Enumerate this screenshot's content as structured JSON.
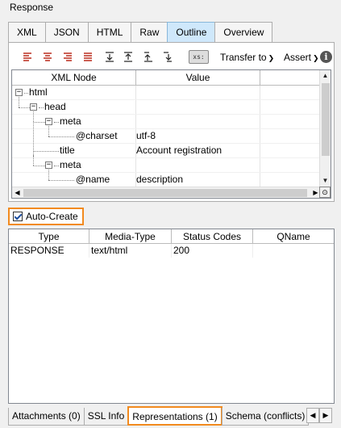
{
  "panel": {
    "title": "Response"
  },
  "format_tabs": [
    {
      "label": "XML"
    },
    {
      "label": "JSON"
    },
    {
      "label": "HTML"
    },
    {
      "label": "Raw"
    },
    {
      "label": "Outline",
      "active": true
    },
    {
      "label": "Overview"
    }
  ],
  "toolbar": {
    "icons": [
      "align-left-icon",
      "align-center-icon",
      "align-right-icon",
      "align-justify-icon",
      "collapse-all-icon",
      "expand-all-icon",
      "move-up-icon",
      "move-down-icon"
    ],
    "xs_label": "xs:",
    "transfer_label": "Transfer to",
    "assert_label": "Assert",
    "info_glyph": "i"
  },
  "outline_table": {
    "columns": [
      "XML Node",
      "Value"
    ],
    "rows": [
      {
        "node": "html",
        "value": ""
      },
      {
        "node": "head",
        "value": ""
      },
      {
        "node": "meta",
        "value": ""
      },
      {
        "node": "@charset",
        "value": "utf-8"
      },
      {
        "node": "title",
        "value": "Account registration"
      },
      {
        "node": "meta",
        "value": ""
      },
      {
        "node": "@name",
        "value": "description"
      }
    ]
  },
  "auto_create": {
    "label": "Auto-Create",
    "checked": true
  },
  "representations_table": {
    "columns": [
      "Type",
      "Media-Type",
      "Status Codes",
      "QName"
    ],
    "rows": [
      {
        "type": "RESPONSE",
        "media_type": "text/html",
        "status_codes": "200",
        "qname": ""
      }
    ]
  },
  "bottom_tabs": [
    {
      "label": "Attachments (0)"
    },
    {
      "label": "SSL Info"
    },
    {
      "label": "Representations (1)",
      "active": true
    },
    {
      "label": "Schema (conflicts)"
    }
  ],
  "colors": {
    "highlight": "#f28a1e",
    "active_tab": "#cfe8fb",
    "icon_red": "#c0392b"
  }
}
